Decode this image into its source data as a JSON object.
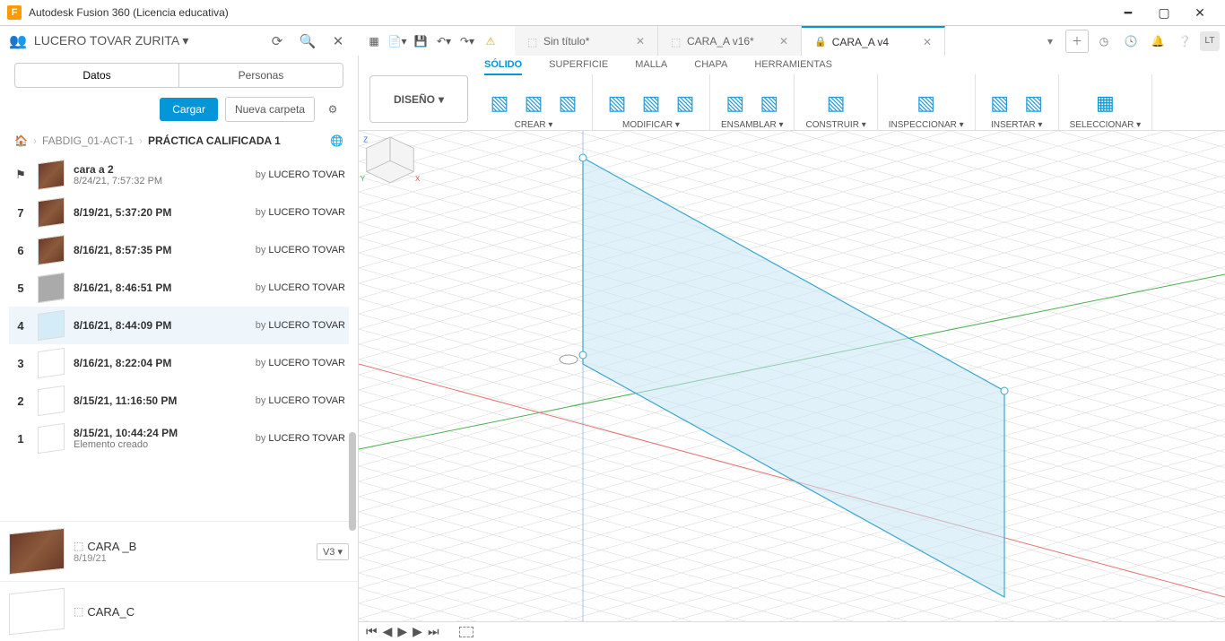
{
  "titlebar": {
    "app_title": "Autodesk Fusion 360 (Licencia educativa)",
    "logo_letter": "F"
  },
  "userbar": {
    "username": "LUCERO TOVAR ZURITA",
    "avatar_initials": "LT",
    "doctabs": [
      {
        "label": "Sin título*",
        "active": false,
        "locked": false
      },
      {
        "label": "CARA_A v16*",
        "active": false,
        "locked": false
      },
      {
        "label": "CARA_A v4",
        "active": true,
        "locked": true
      }
    ]
  },
  "datapanel": {
    "tabs": {
      "data": "Datos",
      "people": "Personas"
    },
    "upload_label": "Cargar",
    "newfolder_label": "Nueva carpeta",
    "breadcrumb": [
      "FABDIG_01-ACT-1",
      "PRÁCTICA CALIFICADA 1"
    ],
    "by_prefix": "by",
    "versions": [
      {
        "badge": "flag",
        "thumb": "wood",
        "title": "cara a 2",
        "ts": "8/24/21, 7:57:32 PM",
        "author": "LUCERO TOVAR"
      },
      {
        "badge": "7",
        "thumb": "wood",
        "title": "8/19/21, 5:37:20 PM",
        "ts": "",
        "author": "LUCERO TOVAR"
      },
      {
        "badge": "6",
        "thumb": "wood",
        "title": "8/16/21, 8:57:35 PM",
        "ts": "",
        "author": "LUCERO TOVAR"
      },
      {
        "badge": "5",
        "thumb": "grey",
        "title": "8/16/21, 8:46:51 PM",
        "ts": "",
        "author": "LUCERO TOVAR"
      },
      {
        "badge": "4",
        "thumb": "blue",
        "title": "8/16/21, 8:44:09 PM",
        "ts": "",
        "author": "LUCERO TOVAR",
        "selected": true
      },
      {
        "badge": "3",
        "thumb": "white",
        "title": "8/16/21, 8:22:04 PM",
        "ts": "",
        "author": "LUCERO TOVAR"
      },
      {
        "badge": "2",
        "thumb": "white",
        "title": "8/15/21, 11:16:50 PM",
        "ts": "",
        "author": "LUCERO TOVAR"
      },
      {
        "badge": "1",
        "thumb": "white",
        "title": "8/15/21, 10:44:24 PM",
        "ts": "Elemento creado",
        "author": "LUCERO TOVAR"
      }
    ],
    "assets": [
      {
        "name": "CARA _B",
        "date": "8/19/21",
        "version": "V3 ▾",
        "thumb": "wood"
      },
      {
        "name": "CARA_C",
        "date": "",
        "version": "",
        "thumb": "tri"
      }
    ]
  },
  "ribbon": {
    "workspace_label": "DISEÑO",
    "tabs": [
      "SÓLIDO",
      "SUPERFICIE",
      "MALLA",
      "CHAPA",
      "HERRAMIENTAS"
    ],
    "active_tab": 0,
    "groups": [
      {
        "label": "CREAR ▾",
        "icons": 3
      },
      {
        "label": "MODIFICAR ▾",
        "icons": 3
      },
      {
        "label": "ENSAMBLAR ▾",
        "icons": 2
      },
      {
        "label": "CONSTRUIR ▾",
        "icons": 1
      },
      {
        "label": "INSPECCIONAR ▾",
        "icons": 1
      },
      {
        "label": "INSERTAR ▾",
        "icons": 2
      },
      {
        "label": "SELECCIONAR ▾",
        "icons": 1
      }
    ]
  },
  "viewcube": {
    "axes": [
      "X",
      "Y",
      "Z"
    ]
  }
}
